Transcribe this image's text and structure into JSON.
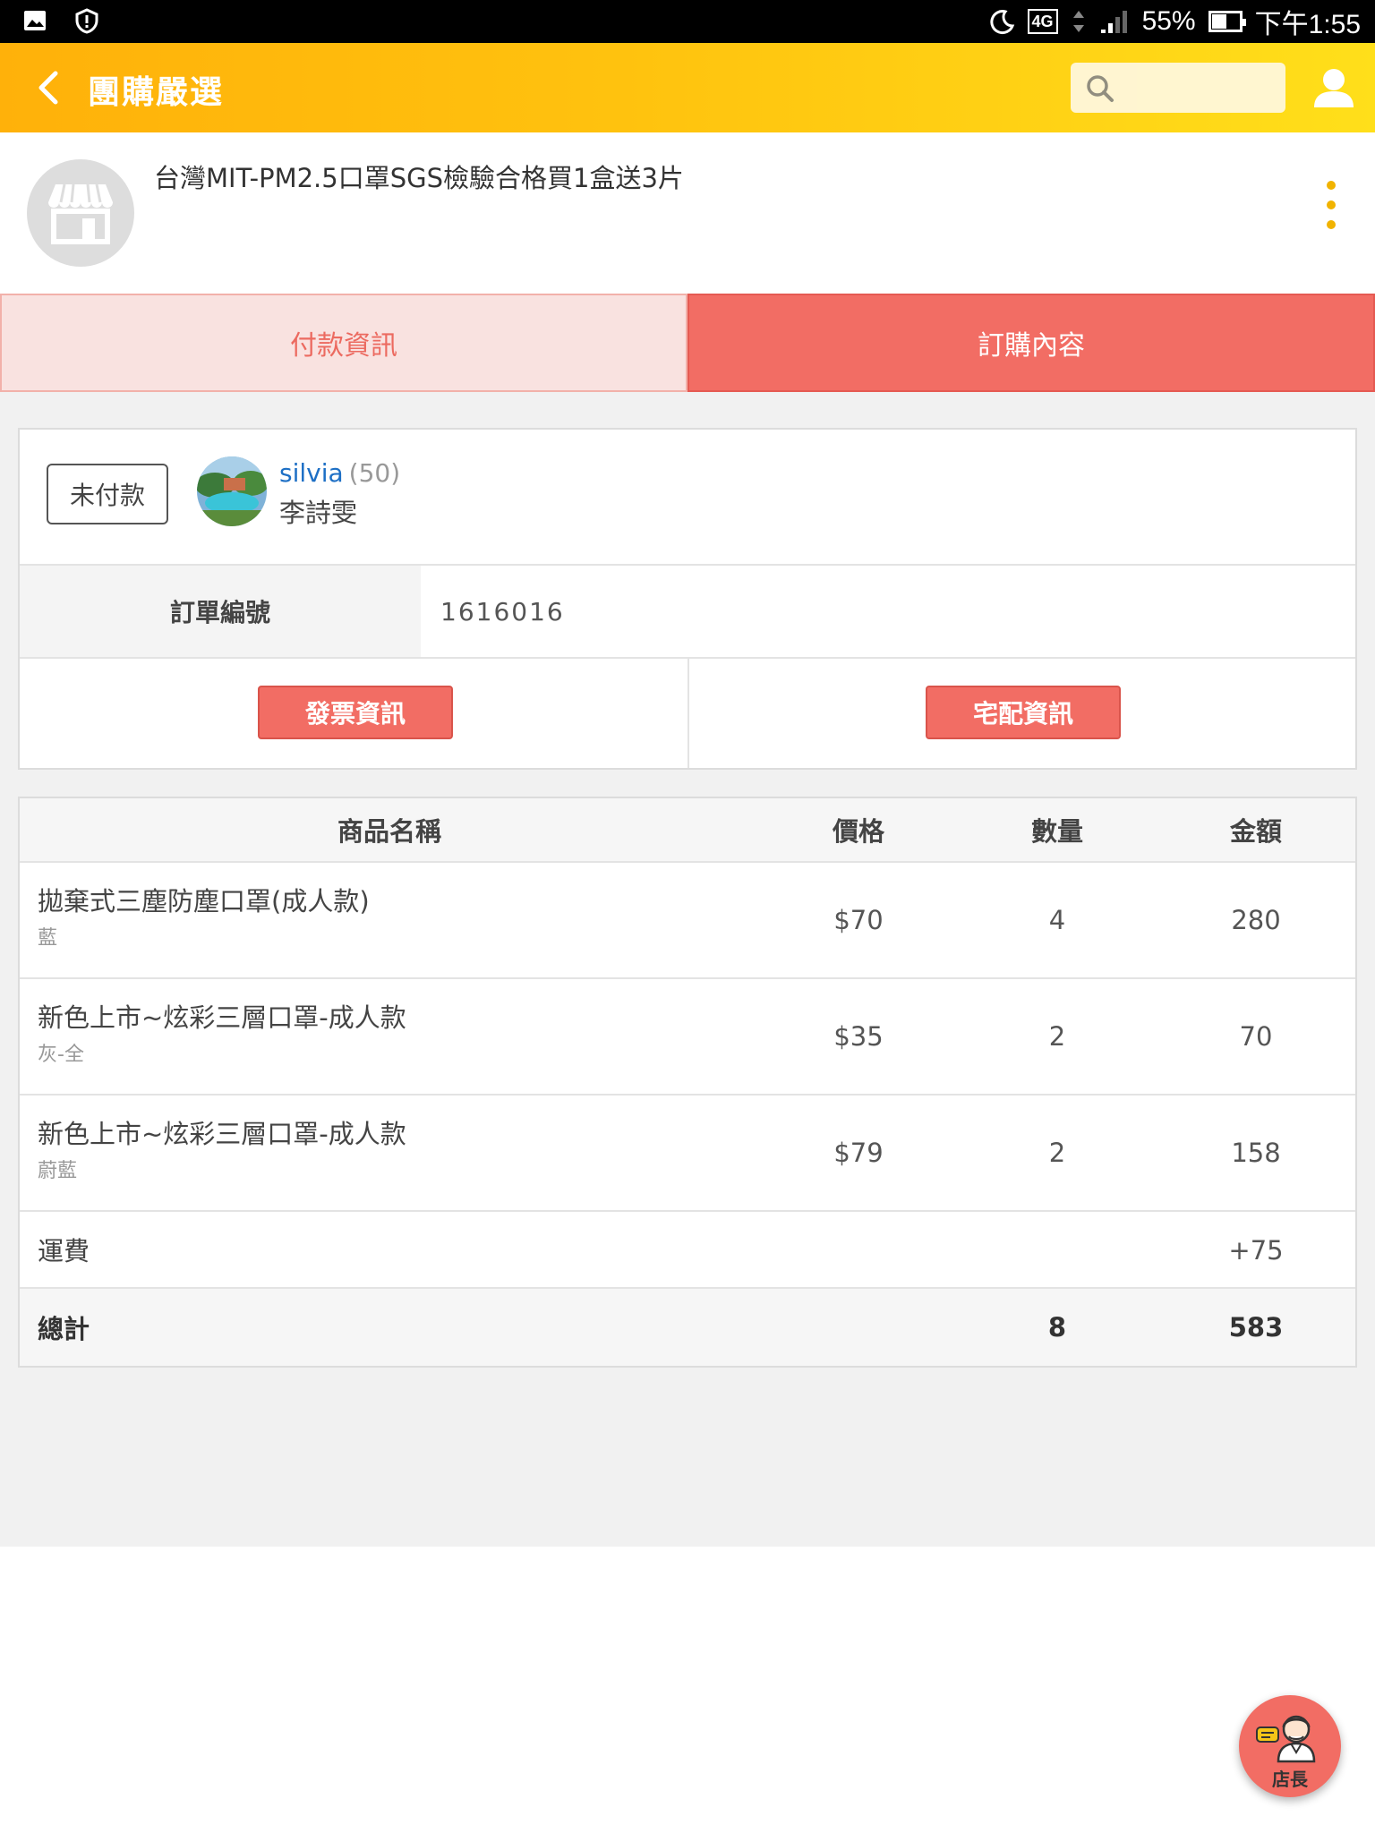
{
  "status_bar": {
    "network": "4G",
    "battery": "55%",
    "battery_level": 0.55,
    "time": "下午1:55"
  },
  "appbar": {
    "title": "團購嚴選",
    "search_placeholder": ""
  },
  "shop": {
    "title": "台灣MIT-PM2.5口罩SGS檢驗合格買1盒送3片"
  },
  "tabs": [
    {
      "label": "付款資訊",
      "active": false
    },
    {
      "label": "訂購內容",
      "active": true
    }
  ],
  "order": {
    "status": "未付款",
    "buyer_name": "silvia",
    "buyer_count": "(50)",
    "buyer_real_name": "李詩雯",
    "number_label": "訂單編號",
    "number": "1616016",
    "invoice_button": "發票資訊",
    "delivery_button": "宅配資訊"
  },
  "table": {
    "headers": [
      "商品名稱",
      "價格",
      "數量",
      "金額"
    ],
    "rows": [
      {
        "name": "拋棄式三塵防塵口罩(成人款)",
        "variant": "藍",
        "price": "$70",
        "qty": "4",
        "amount": "280"
      },
      {
        "name": "新色上市~炫彩三層口罩-成人款",
        "variant": "灰-全",
        "price": "$35",
        "qty": "2",
        "amount": "70"
      },
      {
        "name": "新色上市~炫彩三層口罩-成人款",
        "variant": "蔚藍",
        "price": "$79",
        "qty": "2",
        "amount": "158"
      }
    ],
    "shipping_label": "運費",
    "shipping_amount": "+75",
    "total_label": "總計",
    "total_qty": "8",
    "total_amount": "583"
  },
  "fab": {
    "label": "店長"
  },
  "colors": {
    "accent": "#f26d64",
    "appbar_start": "#ffb10a",
    "appbar_end": "#ffdf1a",
    "link": "#1d6fc5"
  }
}
